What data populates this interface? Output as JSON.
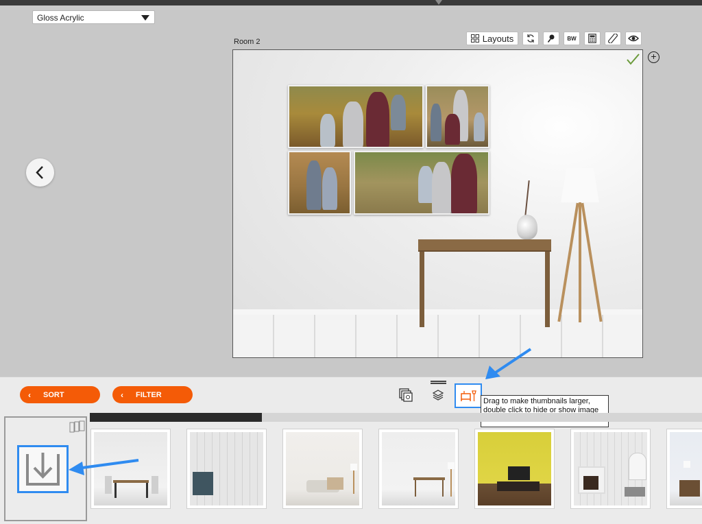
{
  "material": {
    "selected": "Gloss Acrylic"
  },
  "room": {
    "title": "Room 2"
  },
  "toolbar": {
    "layouts_label": "Layouts",
    "bw_label": "BW"
  },
  "controls": {
    "sort_label": "SORT",
    "filter_label": "FILTER"
  },
  "tooltip": {
    "text": "Drag to make thumbnails larger, double click to hide or show image well."
  },
  "scroll": {
    "position_fraction": 0.28
  },
  "thumbnails": [
    {
      "room": "dining"
    },
    {
      "room": "paneled-wall-cabinet"
    },
    {
      "room": "sofa"
    },
    {
      "room": "console-table"
    },
    {
      "room": "yellow-media"
    },
    {
      "room": "fireplace"
    },
    {
      "room": "dresser"
    }
  ],
  "colors": {
    "accent_orange": "#f45b07",
    "highlight_blue": "#2f8bf0",
    "canvas_gray": "#c8c8c8"
  },
  "icons": [
    "gallery-icon",
    "layers-icon",
    "rooms-icon",
    "refresh-icon",
    "pin-icon",
    "calculator-icon",
    "ruler-icon",
    "eye-icon",
    "chevron-left-icon",
    "checkmark-icon",
    "add-icon",
    "import-icon",
    "filmstrip-icon"
  ]
}
